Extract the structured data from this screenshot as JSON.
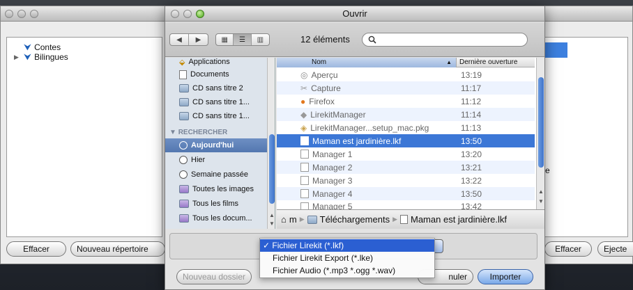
{
  "background_window": {
    "tree": [
      {
        "label": "Contes",
        "expanded": true
      },
      {
        "label": "Bilingues",
        "expanded": false
      }
    ],
    "buttons": {
      "effacer": "Effacer",
      "nouveau_repertoire": "Nouveau répertoire",
      "effacer_right": "Effacer",
      "ejecter": "Ejecte"
    },
    "partial_text": "e"
  },
  "dialog": {
    "title": "Ouvrir",
    "item_count": "12 éléments",
    "search": {
      "value": "",
      "placeholder": ""
    },
    "sidebar": {
      "items_top": [
        "Applications",
        "Documents",
        "CD sans titre 2",
        "CD sans titre 1...",
        "CD sans titre 1..."
      ],
      "section": "RECHERCHER",
      "search_items": [
        "Aujourd'hui",
        "Hier",
        "Semaine passée",
        "Toutes les images",
        "Tous les films",
        "Tous les docum..."
      ],
      "selected": "Aujourd'hui"
    },
    "columns": {
      "name": "Nom",
      "date": "Dernière ouverture"
    },
    "files": [
      {
        "name": "Aperçu",
        "time": "13:19"
      },
      {
        "name": "Capture",
        "time": "11:17"
      },
      {
        "name": "Firefox",
        "time": "11:12"
      },
      {
        "name": "LirekitManager",
        "time": "11:14"
      },
      {
        "name": "LirekitManager...setup_mac.pkg",
        "time": "11:13"
      },
      {
        "name": "Maman est jardinière.lkf",
        "time": "13:50",
        "selected": true
      },
      {
        "name": "Manager 1",
        "time": "13:20"
      },
      {
        "name": "Manager 2",
        "time": "13:21"
      },
      {
        "name": "Manager 3",
        "time": "13:22"
      },
      {
        "name": "Manager 4",
        "time": "13:50"
      },
      {
        "name": "Manager 5",
        "time": "13:42"
      }
    ],
    "path": {
      "home": "m",
      "folder": "Téléchargements",
      "file": "Maman est jardinière.lkf"
    },
    "format_menu": {
      "options": [
        "Fichier Lirekit (*.lkf)",
        "Fichier Lirekit Export (*.lke)",
        "Fichier Audio (*.mp3 *.ogg *.wav)"
      ],
      "selected": "Fichier Lirekit (*.lkf)",
      "check": "✓"
    },
    "buttons": {
      "new_folder": "Nouveau dossier",
      "cancel": "nuler",
      "import": "Importer"
    }
  },
  "colors": {
    "accent": "#3c77d6",
    "sidebar_bg": "#dde4ec",
    "menu_highlight": "#2b5fd2"
  },
  "icons": {
    "back": "chevron-left-icon",
    "forward": "chevron-right-icon",
    "search": "magnifier-icon",
    "home": "house-icon",
    "folder": "folder-icon"
  }
}
